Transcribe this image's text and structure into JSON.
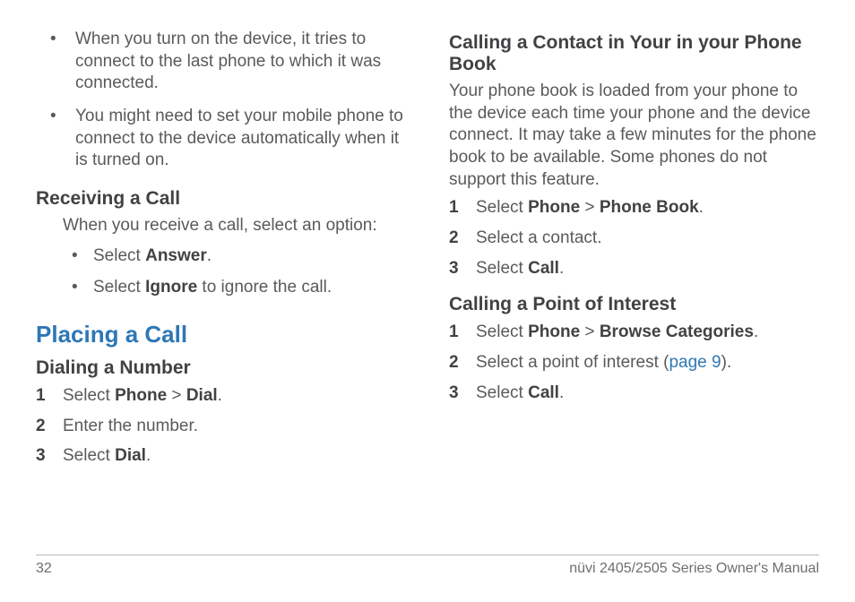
{
  "left": {
    "topBullets": [
      "When you turn on the device, it tries to connect to the last phone to which it was connected.",
      "You might need to set your mobile phone to connect to the device automatically when it is turned on."
    ],
    "receiving": {
      "heading": "Receiving a Call",
      "intro": "When you receive a call, select an option:",
      "answerPrefix": "Select ",
      "answerBold": "Answer",
      "answerSuffix": ".",
      "ignorePrefix": "Select ",
      "ignoreBold": "Ignore",
      "ignoreSuffix": " to ignore the call."
    },
    "placing": {
      "heading": "Placing a Call",
      "dialing": {
        "heading": "Dialing a Number",
        "step1Prefix": "Select ",
        "step1B1": "Phone",
        "step1Sep": " > ",
        "step1B2": "Dial",
        "step1Suffix": ".",
        "step2": "Enter the number.",
        "step3Prefix": "Select ",
        "step3B": "Dial",
        "step3Suffix": "."
      }
    }
  },
  "right": {
    "phonebook": {
      "heading": "Calling a Contact in Your in your Phone Book",
      "intro": "Your phone book is loaded from your phone to the device each time your phone and the device connect. It may take a few minutes for the phone book to be available. Some phones do not support this feature.",
      "step1Prefix": "Select ",
      "step1B1": "Phone",
      "step1Sep": " > ",
      "step1B2": "Phone Book",
      "step1Suffix": ".",
      "step2": "Select a contact.",
      "step3Prefix": "Select ",
      "step3B": "Call",
      "step3Suffix": "."
    },
    "poi": {
      "heading": "Calling a Point of Interest",
      "step1Prefix": "Select ",
      "step1B1": "Phone",
      "step1Sep": " > ",
      "step1B2": "Browse Categories",
      "step1Suffix": ".",
      "step2Prefix": "Select a point of interest (",
      "step2Link": "page 9",
      "step2Suffix": ").",
      "step3Prefix": "Select ",
      "step3B": "Call",
      "step3Suffix": "."
    }
  },
  "footer": {
    "pageNum": "32",
    "manual": "nüvi 2405/2505 Series Owner's Manual"
  }
}
